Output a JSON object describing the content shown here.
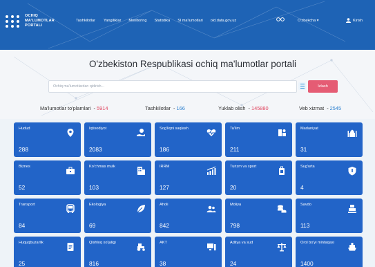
{
  "header": {
    "logo_lines": [
      "OCHIQ",
      "MA'LUMOTLAR",
      "PORTALI"
    ],
    "nav": [
      "Tashkilotlar",
      "Yangiliklar",
      "Monitoring",
      "Statistika",
      "Sl ma'lumotlari",
      "old.data.gov.uz"
    ],
    "lang": "O'zbekcha ▾",
    "login": "Kirish",
    "glasses_icon": "glasses-icon"
  },
  "hero": {
    "title": "O'zbekiston Respublikasi ochiq ma'lumotlar portali",
    "search_placeholder": "Ochiq ma'lumotlardan qidirish...",
    "search_button": "Izlash"
  },
  "stats": [
    {
      "label": "Ma'lumotlar to'plamlari",
      "value": "5914",
      "color": "#e0445f"
    },
    {
      "label": "Tashkilotlar",
      "value": "166",
      "color": "#2a7fcf"
    },
    {
      "label": "Yuklab olish",
      "value": "145880",
      "color": "#e0445f"
    },
    {
      "label": "Veb xizmat",
      "value": "2545",
      "color": "#2a7fcf"
    }
  ],
  "tiles": [
    {
      "label": "Hudud",
      "count": "288",
      "icon": "location-pin-icon"
    },
    {
      "label": "Iqtisodiyot",
      "count": "2083",
      "icon": "money-hand-icon"
    },
    {
      "label": "Sog'liqni saqlash",
      "count": "186",
      "icon": "heart-pulse-icon"
    },
    {
      "label": "Ta'lim",
      "count": "211",
      "icon": "education-icon"
    },
    {
      "label": "Madaniyat",
      "count": "31",
      "icon": "mosque-icon"
    },
    {
      "label": "Biznes",
      "count": "52",
      "icon": "briefcase-icon"
    },
    {
      "label": "Ko'chmas mulk",
      "count": "103",
      "icon": "building-icon"
    },
    {
      "label": "IRRM",
      "count": "127",
      "icon": "bar-chart-icon"
    },
    {
      "label": "Turizm va sport",
      "count": "20",
      "icon": "luggage-icon"
    },
    {
      "label": "Sug'urta",
      "count": "4",
      "icon": "shield-icon"
    },
    {
      "label": "Transport",
      "count": "84",
      "icon": "bus-icon"
    },
    {
      "label": "Ekologiya",
      "count": "69",
      "icon": "leaf-icon"
    },
    {
      "label": "Aholi",
      "count": "842",
      "icon": "users-icon"
    },
    {
      "label": "Moliya",
      "count": "798",
      "icon": "coins-icon"
    },
    {
      "label": "Savdo",
      "count": "113",
      "icon": "cash-register-icon"
    },
    {
      "label": "Huquqbuzarlik",
      "count": "25",
      "icon": "document-icon"
    },
    {
      "label": "Qishloq xo'jaligi",
      "count": "816",
      "icon": "tractor-icon"
    },
    {
      "label": "AKT",
      "count": "38",
      "icon": "computer-icon"
    },
    {
      "label": "Adliya va sud",
      "count": "24",
      "icon": "scales-icon"
    },
    {
      "label": "Orol bo'yi mintaqasi",
      "count": "1400",
      "icon": "ship-icon"
    }
  ]
}
